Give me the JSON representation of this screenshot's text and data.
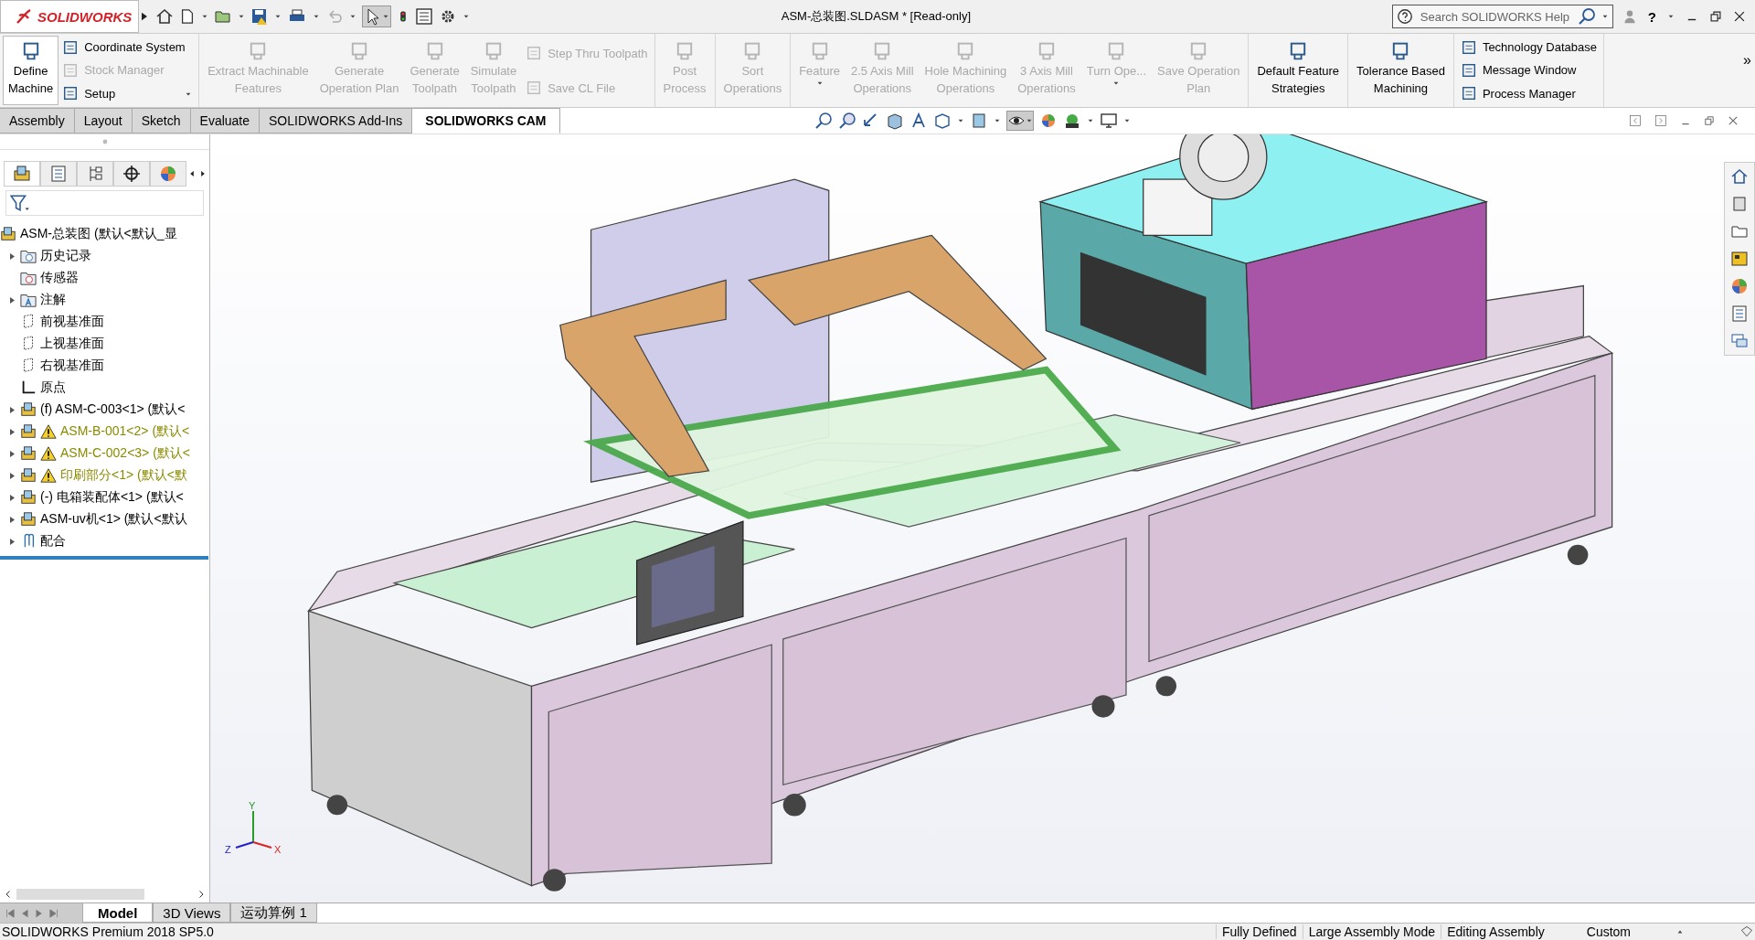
{
  "title_bar": {
    "logo": "SOLIDWORKS",
    "title": "ASM-总装图.SLDASM * [Read-only]",
    "search": {
      "placeholder": "Search SOLIDWORKS Help"
    },
    "help": "?"
  },
  "ribbon": {
    "sections": [
      {
        "items": [
          {
            "kind": "large",
            "label": "Define\nMachine",
            "disabled": false,
            "dropdown": false
          },
          {
            "kind": "stack",
            "items": [
              {
                "label": "Coordinate System",
                "disabled": false,
                "dropdown": false
              },
              {
                "label": "Stock Manager",
                "disabled": true,
                "dropdown": false
              },
              {
                "label": "Setup",
                "disabled": false,
                "dropdown": true
              }
            ]
          }
        ]
      },
      {
        "items": [
          {
            "kind": "large",
            "label": "Extract Machinable\nFeatures",
            "disabled": true,
            "dropdown": false
          },
          {
            "kind": "large",
            "label": "Generate\nOperation Plan",
            "disabled": true,
            "dropdown": false
          },
          {
            "kind": "large",
            "label": "Generate\nToolpath",
            "disabled": true,
            "dropdown": false
          },
          {
            "kind": "large",
            "label": "Simulate\nToolpath",
            "disabled": true,
            "dropdown": false
          },
          {
            "kind": "stack",
            "items": [
              {
                "label": "Step Thru Toolpath",
                "disabled": true,
                "dropdown": false
              },
              {
                "label": "Save CL File",
                "disabled": true,
                "dropdown": false
              }
            ]
          }
        ]
      },
      {
        "items": [
          {
            "kind": "large",
            "label": "Post\nProcess",
            "disabled": true,
            "dropdown": false
          }
        ]
      },
      {
        "items": [
          {
            "kind": "large",
            "label": "Sort\nOperations",
            "disabled": true,
            "dropdown": false
          }
        ]
      },
      {
        "items": [
          {
            "kind": "large",
            "label": "Feature",
            "disabled": true,
            "dropdown": true
          },
          {
            "kind": "large",
            "label": "2.5 Axis Mill\nOperations",
            "disabled": true,
            "dropdown": false
          },
          {
            "kind": "large",
            "label": "Hole Machining\nOperations",
            "disabled": true,
            "dropdown": false
          },
          {
            "kind": "large",
            "label": "3 Axis Mill\nOperations",
            "disabled": true,
            "dropdown": false
          },
          {
            "kind": "large",
            "label": "Turn Ope...",
            "disabled": true,
            "dropdown": true
          },
          {
            "kind": "large",
            "label": "Save Operation\nPlan",
            "disabled": true,
            "dropdown": false
          }
        ]
      },
      {
        "items": [
          {
            "kind": "large",
            "label": "Default Feature\nStrategies",
            "disabled": false,
            "dropdown": false
          }
        ]
      },
      {
        "items": [
          {
            "kind": "large",
            "label": "Tolerance Based\nMachining",
            "disabled": false,
            "dropdown": false
          }
        ]
      },
      {
        "items": [
          {
            "kind": "stack",
            "items": [
              {
                "label": "Technology Database",
                "disabled": false,
                "dropdown": false
              },
              {
                "label": "Message Window",
                "disabled": false,
                "dropdown": false
              },
              {
                "label": "Process Manager",
                "disabled": false,
                "dropdown": false
              }
            ]
          }
        ]
      }
    ],
    "overflow": "»"
  },
  "command_tabs": [
    {
      "label": "Assembly",
      "selected": false
    },
    {
      "label": "Layout",
      "selected": false
    },
    {
      "label": "Sketch",
      "selected": false
    },
    {
      "label": "Evaluate",
      "selected": false
    },
    {
      "label": "SOLIDWORKS Add-Ins",
      "selected": false
    },
    {
      "label": "SOLIDWORKS CAM",
      "selected": true
    }
  ],
  "feature_tree": {
    "root": {
      "label": "ASM-总装图  (默认<默认_显",
      "children": [
        {
          "kind": "history",
          "label": "历史记录",
          "expandable": true,
          "warning": false
        },
        {
          "kind": "sensor",
          "label": "传感器",
          "expandable": false,
          "warning": false
        },
        {
          "kind": "annotation",
          "label": "注解",
          "expandable": true,
          "warning": false
        },
        {
          "kind": "plane",
          "label": "前视基准面",
          "expandable": false,
          "warning": false
        },
        {
          "kind": "plane",
          "label": "上视基准面",
          "expandable": false,
          "warning": false
        },
        {
          "kind": "plane",
          "label": "右视基准面",
          "expandable": false,
          "warning": false
        },
        {
          "kind": "origin",
          "label": "原点",
          "expandable": false,
          "warning": false
        },
        {
          "kind": "assembly",
          "label": "(f) ASM-C-003<1> (默认<",
          "expandable": true,
          "warning": false
        },
        {
          "kind": "assembly",
          "label": "ASM-B-001<2> (默认<",
          "expandable": true,
          "warning": true
        },
        {
          "kind": "assembly",
          "label": "ASM-C-002<3> (默认<",
          "expandable": true,
          "warning": true
        },
        {
          "kind": "assembly",
          "label": "印刷部分<1> (默认<默",
          "expandable": true,
          "warning": true
        },
        {
          "kind": "assembly",
          "label": "(-) 电箱装配体<1> (默认<",
          "expandable": true,
          "warning": false
        },
        {
          "kind": "assembly",
          "label": "ASM-uv机<1> (默认<默认",
          "expandable": true,
          "warning": false
        },
        {
          "kind": "mates",
          "label": "配合",
          "expandable": true,
          "warning": false
        }
      ]
    }
  },
  "panel_tabs": [
    {
      "selected": true
    },
    {
      "selected": false
    },
    {
      "selected": false
    },
    {
      "selected": false
    },
    {
      "selected": false
    }
  ],
  "triad": {
    "x": "X",
    "y": "Y",
    "z": "Z"
  },
  "bottom_tabs": [
    {
      "label": "Model",
      "selected": true
    },
    {
      "label": "3D Views",
      "selected": false
    },
    {
      "label": "运动算例 1",
      "selected": false
    }
  ],
  "status_bar": {
    "product": "SOLIDWORKS Premium 2018 SP5.0",
    "items": [
      "Fully Defined",
      "Large Assembly Mode",
      "Editing Assembly"
    ],
    "units": "Custom"
  }
}
